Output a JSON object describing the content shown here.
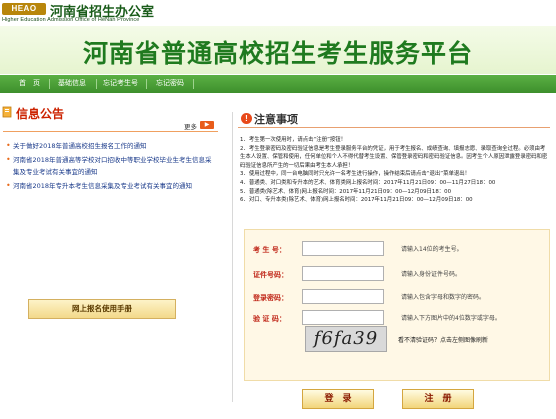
{
  "header": {
    "logo_text": "HEAO",
    "office_name": "河南省招生办公室",
    "office_name_en": "Higher Education Admission Office of HeNan Province"
  },
  "banner": {
    "title": "河南省普通高校招生考生服务平台"
  },
  "nav": {
    "items": [
      {
        "label": "首　页"
      },
      {
        "label": "基础信息"
      },
      {
        "label": "忘记考生号"
      },
      {
        "label": "忘记密码"
      }
    ]
  },
  "notices": {
    "title": "信息公告",
    "more_label": "更多",
    "more_icon": "more-arrow-icon",
    "items": [
      "关于做好2018年普通高校招生报名工作的通知",
      "河南省2018年普通高等学校对口招收中等职业学校毕业生考生信息采集及专业考试有关事宜的通知",
      "河南省2018年专升本考生信息采集及专业考试有关事宜的通知"
    ]
  },
  "attention": {
    "title": "注意事项",
    "icon": "exclamation-icon",
    "items": [
      "1．考生第一次使用时，请点击“注册”按钮！",
      "2．考生登录密码及密码验证信息是考生登录服务平台的凭证，用于考生报名、成绩查询、填报志愿、录取查询全过程。必须由考生本人设置、保管和使用，任何单位和个人不得代替考生设置、保管登录密码和密码验证信息。因考生个人原因泄露登录密码和密码验证信息所产生的一切后果由考生本人承担！",
      "3．使用过程中，同一台电脑同时只允许一名考生进行操作，操作结束后请点击“退出”菜单退出！",
      "4．普通类、对口类和专升本的艺术、体育类网上报名时间：2017年11月21日09：00—11月27日18：00",
      "5．普通类(除艺术、体育)网上报名时间：2017年11月21日09：00—12月09日18：00",
      "6．对口、专升本类(除艺术、体育)网上报名时间：2017年11月21日09：00—12月09日18：00"
    ]
  },
  "login": {
    "fields": [
      {
        "label": "考 生 号：",
        "value": "",
        "hint": "请输入14位的考生号。"
      },
      {
        "label": "证件号码：",
        "value": "",
        "hint": "请输入身份证件号码。"
      },
      {
        "label": "登录密码：",
        "value": "",
        "hint": "请输入包含字母和数字的密码。"
      },
      {
        "label": "验 证 码：",
        "value": "",
        "hint": "请输入下方图片中的4位数字或字母。"
      }
    ],
    "captcha_text": "f6fa39",
    "captcha_hint": "看不清验证码？点击左侧图像刷新",
    "login_label": "登　录",
    "register_label": "注　册"
  },
  "footer": {
    "manual_label": "网上报名使用手册"
  },
  "colors": {
    "brand_green": "#1f7a1f",
    "nav_green": "#3d8f2c",
    "accent_red": "#cc2200",
    "link_blue": "#1a3a8a"
  }
}
